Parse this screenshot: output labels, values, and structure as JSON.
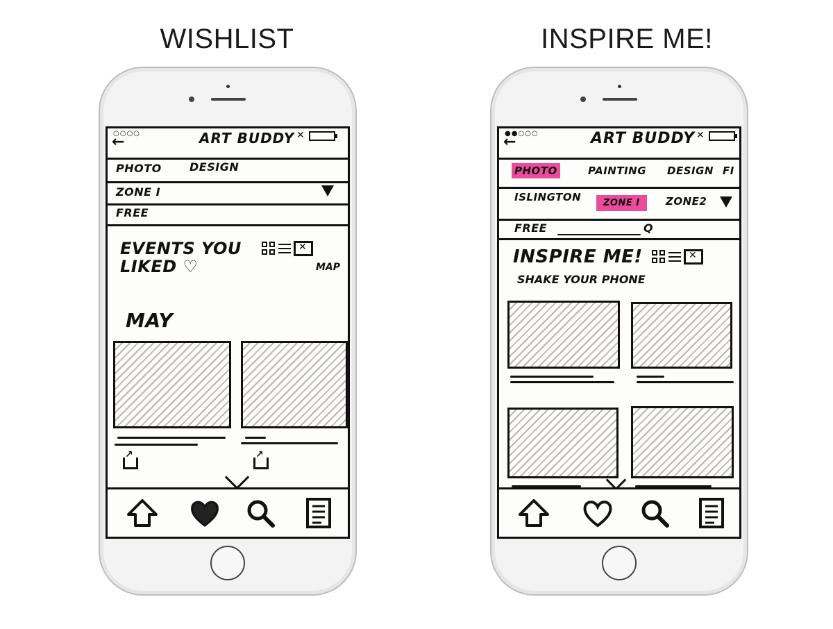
{
  "left": {
    "caption": "WISHLIST",
    "status": {
      "signal": "○○○○",
      "title": "ART BUDDY",
      "battery_x": "✕",
      "back_arrow": "←"
    },
    "filters": {
      "cat1": "PHOTO",
      "cat2": "DESIGN",
      "zone": "ZONE I",
      "price": "FREE"
    },
    "section": {
      "title_line1": "EVENTS YOU",
      "title_line2": "LIKED ♡",
      "map_label": "MAP",
      "month": "MAY"
    }
  },
  "right": {
    "caption": "INSPIRE ME!",
    "status": {
      "signal": "●●○○○",
      "title": "ART BUDDY",
      "battery_x": "✕",
      "back_arrow": "←"
    },
    "filters": {
      "cat1": "PHOTO",
      "cat2": "PAINTING",
      "cat3": "DESIGN",
      "cat4": "FI",
      "loc1": "ISLINGTON",
      "loc2": "ZONE I",
      "loc3": "ZONE2",
      "price": "FREE",
      "search_icon": "Q"
    },
    "section": {
      "title": "INSPIRE ME!",
      "subtitle": "SHAKE YOUR PHONE"
    }
  },
  "colors": {
    "highlight": "#ec4b9b",
    "ink": "#111111",
    "hatch": "#bdb6b0"
  },
  "icons": [
    "home-icon",
    "heart-icon",
    "search-icon",
    "list-icon",
    "grid-view-icon",
    "list-view-icon",
    "map-view-icon",
    "share-icon",
    "chevron-down-icon",
    "dropdown-triangle-icon"
  ]
}
